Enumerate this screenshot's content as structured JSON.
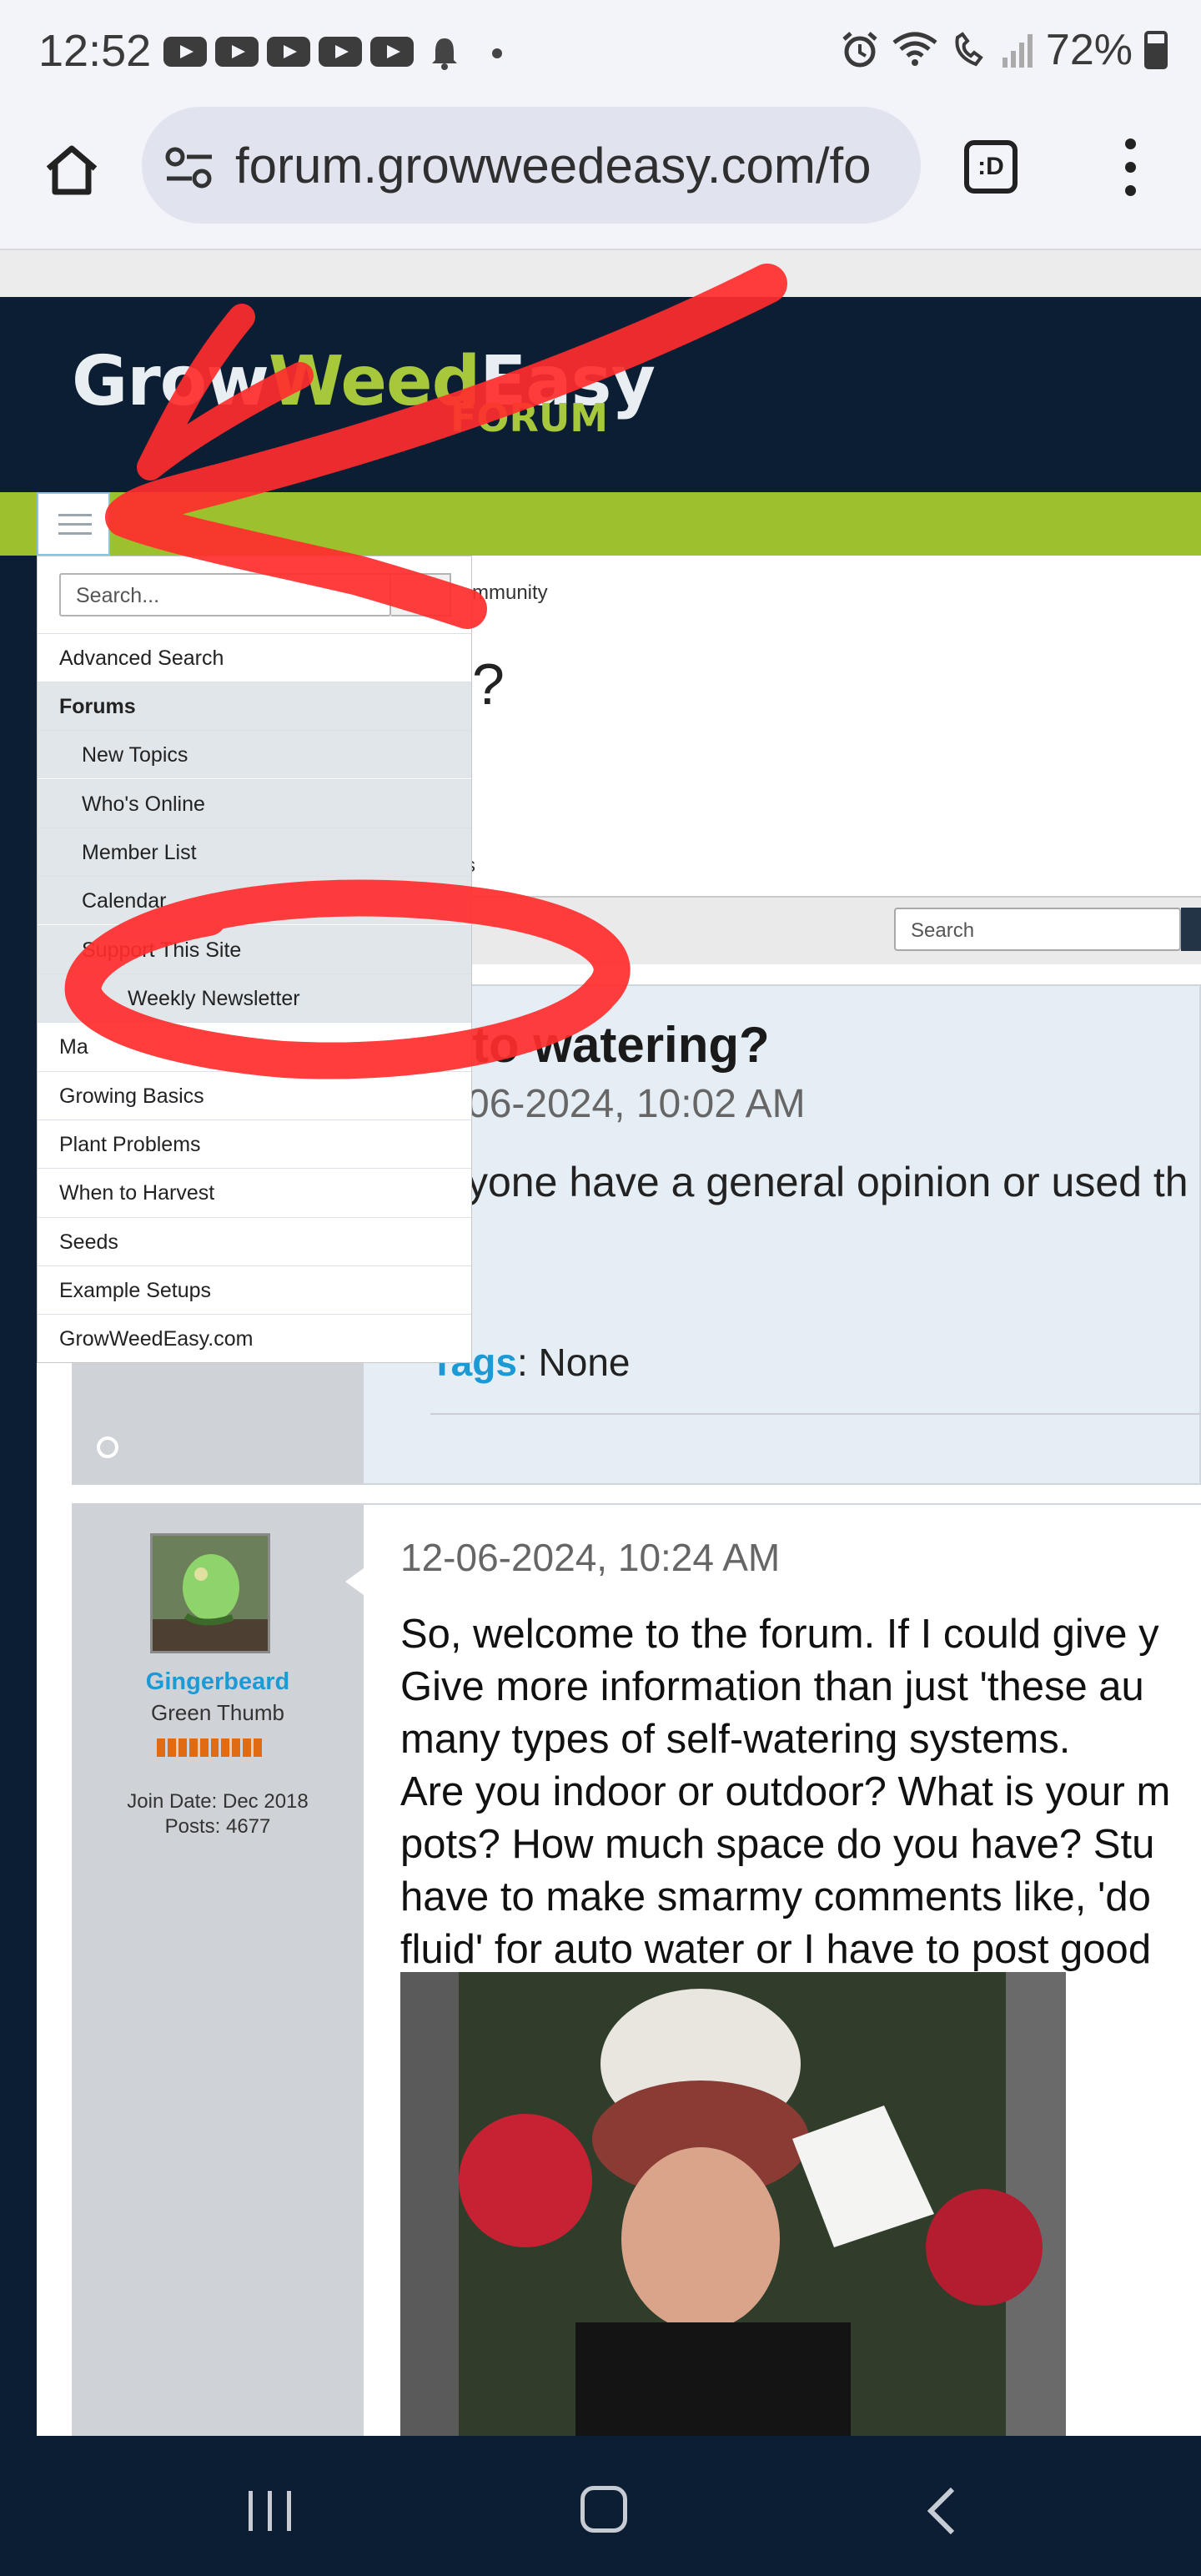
{
  "status_bar": {
    "time": "12:52",
    "battery": "72%",
    "icons": [
      "youtube-icon",
      "youtube-icon",
      "youtube-icon",
      "youtube-icon",
      "youtube-icon",
      "bell-icon",
      "dot-icon",
      "alarm-icon",
      "wifi-call-icon",
      "wifi-call-icon",
      "signal-icon",
      "battery-icon"
    ]
  },
  "browser": {
    "url": "forum.growweedeasy.com/fo",
    "tabs_label": ":D"
  },
  "header": {
    "logo_grow": "Grow",
    "logo_weed": "Weed",
    "logo_easy": "Easy",
    "logo_forum": "FORUM"
  },
  "breadcrumb_tail": "mmunity",
  "page_title_tail": "?",
  "tab_tail": "s",
  "search": {
    "placeholder": "Search"
  },
  "menu": {
    "search_placeholder": "Search...",
    "items": [
      {
        "label": "Advanced Search"
      },
      {
        "label": "Forums"
      },
      {
        "label": "New Topics"
      },
      {
        "label": "Who's Online"
      },
      {
        "label": "Member List"
      },
      {
        "label": "Calendar"
      },
      {
        "label": "Support This Site"
      },
      {
        "label": "Weekly Newsletter"
      },
      {
        "label": "Ma"
      },
      {
        "label": "Growing Basics"
      },
      {
        "label": "Plant Problems"
      },
      {
        "label": "When to Harvest"
      },
      {
        "label": "Seeds"
      },
      {
        "label": "Example Setups"
      },
      {
        "label": "GrowWeedEasy.com"
      }
    ]
  },
  "post1": {
    "title_tail": "to watering?",
    "date_tail": "06-2024, 10:02 AM",
    "text_tail": "yone have a general opinion or used th",
    "tags_label": "Tags",
    "tags_value": ": None"
  },
  "post2": {
    "username": "Gingerbeard",
    "rank": "Green Thumb",
    "join_date": "Join Date: Dec 2018",
    "posts": "Posts: 4677",
    "date": "12-06-2024, 10:24 AM",
    "text": "So, welcome to the forum. If I could give y\nGive more information than just 'these au\nmany types of self-watering systems.\nAre you indoor or outdoor? What is your m\npots? How much space do you have? Stu\nhave to make smarmy comments like, 'do\nfluid' for auto water or I have to post good"
  },
  "colors": {
    "header_bg": "#0c1e33",
    "accent_green": "#9cc12d",
    "link_blue": "#1c9ad6",
    "annotation_red": "#ff2d2d"
  }
}
